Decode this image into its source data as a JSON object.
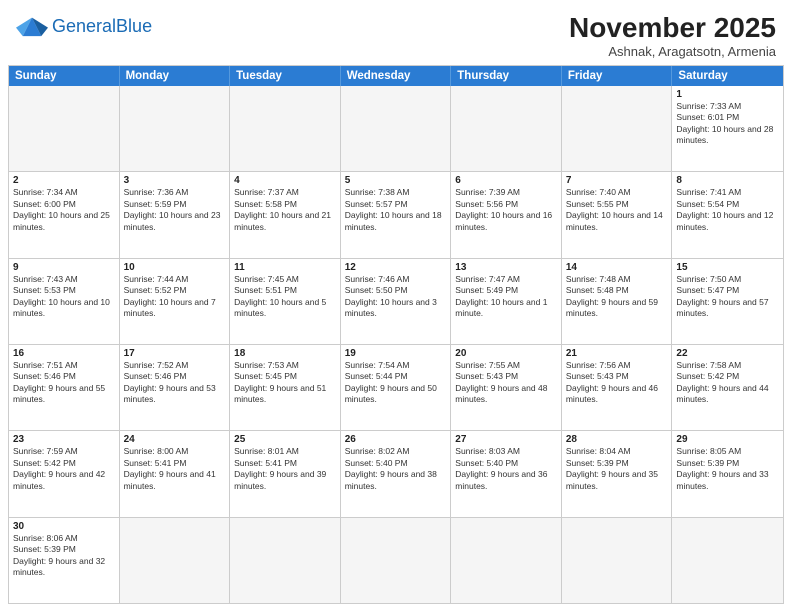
{
  "header": {
    "logo_general": "General",
    "logo_blue": "Blue",
    "month_title": "November 2025",
    "location": "Ashnak, Aragatsotn, Armenia"
  },
  "days_of_week": [
    "Sunday",
    "Monday",
    "Tuesday",
    "Wednesday",
    "Thursday",
    "Friday",
    "Saturday"
  ],
  "weeks": [
    [
      {
        "day": "",
        "empty": true
      },
      {
        "day": "",
        "empty": true
      },
      {
        "day": "",
        "empty": true
      },
      {
        "day": "",
        "empty": true
      },
      {
        "day": "",
        "empty": true
      },
      {
        "day": "",
        "empty": true
      },
      {
        "day": "1",
        "sunrise": "Sunrise: 7:33 AM",
        "sunset": "Sunset: 6:01 PM",
        "daylight": "Daylight: 10 hours and 28 minutes."
      }
    ],
    [
      {
        "day": "2",
        "sunrise": "Sunrise: 7:34 AM",
        "sunset": "Sunset: 6:00 PM",
        "daylight": "Daylight: 10 hours and 25 minutes."
      },
      {
        "day": "3",
        "sunrise": "Sunrise: 7:36 AM",
        "sunset": "Sunset: 5:59 PM",
        "daylight": "Daylight: 10 hours and 23 minutes."
      },
      {
        "day": "4",
        "sunrise": "Sunrise: 7:37 AM",
        "sunset": "Sunset: 5:58 PM",
        "daylight": "Daylight: 10 hours and 21 minutes."
      },
      {
        "day": "5",
        "sunrise": "Sunrise: 7:38 AM",
        "sunset": "Sunset: 5:57 PM",
        "daylight": "Daylight: 10 hours and 18 minutes."
      },
      {
        "day": "6",
        "sunrise": "Sunrise: 7:39 AM",
        "sunset": "Sunset: 5:56 PM",
        "daylight": "Daylight: 10 hours and 16 minutes."
      },
      {
        "day": "7",
        "sunrise": "Sunrise: 7:40 AM",
        "sunset": "Sunset: 5:55 PM",
        "daylight": "Daylight: 10 hours and 14 minutes."
      },
      {
        "day": "8",
        "sunrise": "Sunrise: 7:41 AM",
        "sunset": "Sunset: 5:54 PM",
        "daylight": "Daylight: 10 hours and 12 minutes."
      }
    ],
    [
      {
        "day": "9",
        "sunrise": "Sunrise: 7:43 AM",
        "sunset": "Sunset: 5:53 PM",
        "daylight": "Daylight: 10 hours and 10 minutes."
      },
      {
        "day": "10",
        "sunrise": "Sunrise: 7:44 AM",
        "sunset": "Sunset: 5:52 PM",
        "daylight": "Daylight: 10 hours and 7 minutes."
      },
      {
        "day": "11",
        "sunrise": "Sunrise: 7:45 AM",
        "sunset": "Sunset: 5:51 PM",
        "daylight": "Daylight: 10 hours and 5 minutes."
      },
      {
        "day": "12",
        "sunrise": "Sunrise: 7:46 AM",
        "sunset": "Sunset: 5:50 PM",
        "daylight": "Daylight: 10 hours and 3 minutes."
      },
      {
        "day": "13",
        "sunrise": "Sunrise: 7:47 AM",
        "sunset": "Sunset: 5:49 PM",
        "daylight": "Daylight: 10 hours and 1 minute."
      },
      {
        "day": "14",
        "sunrise": "Sunrise: 7:48 AM",
        "sunset": "Sunset: 5:48 PM",
        "daylight": "Daylight: 9 hours and 59 minutes."
      },
      {
        "day": "15",
        "sunrise": "Sunrise: 7:50 AM",
        "sunset": "Sunset: 5:47 PM",
        "daylight": "Daylight: 9 hours and 57 minutes."
      }
    ],
    [
      {
        "day": "16",
        "sunrise": "Sunrise: 7:51 AM",
        "sunset": "Sunset: 5:46 PM",
        "daylight": "Daylight: 9 hours and 55 minutes."
      },
      {
        "day": "17",
        "sunrise": "Sunrise: 7:52 AM",
        "sunset": "Sunset: 5:46 PM",
        "daylight": "Daylight: 9 hours and 53 minutes."
      },
      {
        "day": "18",
        "sunrise": "Sunrise: 7:53 AM",
        "sunset": "Sunset: 5:45 PM",
        "daylight": "Daylight: 9 hours and 51 minutes."
      },
      {
        "day": "19",
        "sunrise": "Sunrise: 7:54 AM",
        "sunset": "Sunset: 5:44 PM",
        "daylight": "Daylight: 9 hours and 50 minutes."
      },
      {
        "day": "20",
        "sunrise": "Sunrise: 7:55 AM",
        "sunset": "Sunset: 5:43 PM",
        "daylight": "Daylight: 9 hours and 48 minutes."
      },
      {
        "day": "21",
        "sunrise": "Sunrise: 7:56 AM",
        "sunset": "Sunset: 5:43 PM",
        "daylight": "Daylight: 9 hours and 46 minutes."
      },
      {
        "day": "22",
        "sunrise": "Sunrise: 7:58 AM",
        "sunset": "Sunset: 5:42 PM",
        "daylight": "Daylight: 9 hours and 44 minutes."
      }
    ],
    [
      {
        "day": "23",
        "sunrise": "Sunrise: 7:59 AM",
        "sunset": "Sunset: 5:42 PM",
        "daylight": "Daylight: 9 hours and 42 minutes."
      },
      {
        "day": "24",
        "sunrise": "Sunrise: 8:00 AM",
        "sunset": "Sunset: 5:41 PM",
        "daylight": "Daylight: 9 hours and 41 minutes."
      },
      {
        "day": "25",
        "sunrise": "Sunrise: 8:01 AM",
        "sunset": "Sunset: 5:41 PM",
        "daylight": "Daylight: 9 hours and 39 minutes."
      },
      {
        "day": "26",
        "sunrise": "Sunrise: 8:02 AM",
        "sunset": "Sunset: 5:40 PM",
        "daylight": "Daylight: 9 hours and 38 minutes."
      },
      {
        "day": "27",
        "sunrise": "Sunrise: 8:03 AM",
        "sunset": "Sunset: 5:40 PM",
        "daylight": "Daylight: 9 hours and 36 minutes."
      },
      {
        "day": "28",
        "sunrise": "Sunrise: 8:04 AM",
        "sunset": "Sunset: 5:39 PM",
        "daylight": "Daylight: 9 hours and 35 minutes."
      },
      {
        "day": "29",
        "sunrise": "Sunrise: 8:05 AM",
        "sunset": "Sunset: 5:39 PM",
        "daylight": "Daylight: 9 hours and 33 minutes."
      }
    ],
    [
      {
        "day": "30",
        "sunrise": "Sunrise: 8:06 AM",
        "sunset": "Sunset: 5:39 PM",
        "daylight": "Daylight: 9 hours and 32 minutes."
      },
      {
        "day": "",
        "empty": true
      },
      {
        "day": "",
        "empty": true
      },
      {
        "day": "",
        "empty": true
      },
      {
        "day": "",
        "empty": true
      },
      {
        "day": "",
        "empty": true
      },
      {
        "day": "",
        "empty": true
      }
    ]
  ]
}
